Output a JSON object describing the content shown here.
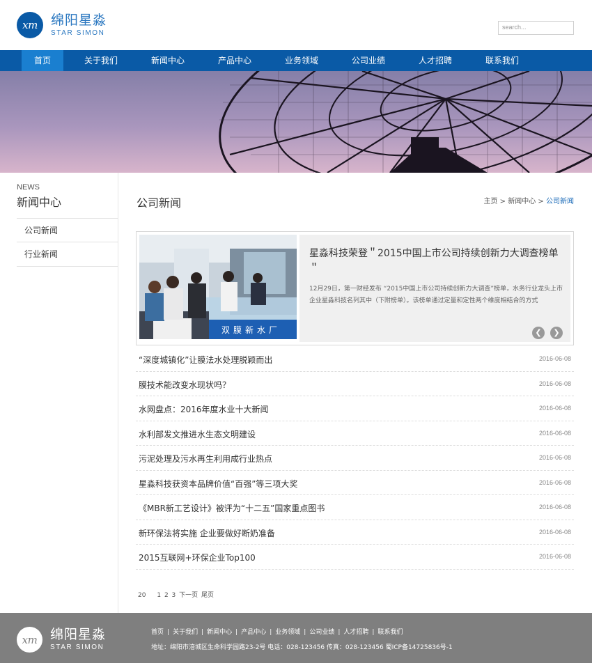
{
  "header": {
    "logo_mark": "xm",
    "logo_cn": "绵阳星淼",
    "logo_en": "STAR SIMON",
    "search_placeholder": "search..."
  },
  "nav": {
    "items": [
      "首页",
      "关于我们",
      "新闻中心",
      "产品中心",
      "业务领域",
      "公司业绩",
      "人才招聘",
      "联系我们"
    ],
    "active_index": 0
  },
  "sidebar": {
    "title_en": "NEWS",
    "title": "新闻中心",
    "items": [
      "公司新闻",
      "行业新闻"
    ]
  },
  "main": {
    "title": "公司新闻",
    "breadcrumb": [
      "主页",
      "新闻中心",
      "公司新闻"
    ],
    "breadcrumb_sep": ">",
    "featured": {
      "title": "星淼科技荣登＂2015中国上市公司持续创新力大调查榜单＂",
      "desc": "12月29日，第一财经发布 “2015中国上市公司持续创新力大调查”榜单，水务行业龙头上市企业星淼科技名列其中（下附榜单）。该榜单通过定量和定性两个维度相结合的方式",
      "image_sign": "双膜新水厂",
      "prev_icon": "chevron-left-icon",
      "next_icon": "chevron-right-icon"
    },
    "news": [
      {
        "title": "“深度城镇化”让膜法水处理脱颖而出",
        "date": "2016-06-08"
      },
      {
        "title": "膜技术能改变水现状吗？",
        "date": "2016-06-08"
      },
      {
        "title": "水网盘点：2016年度水业十大新闻",
        "date": "2016-06-08"
      },
      {
        "title": "水利部发文推进水生态文明建设",
        "date": "2016-06-08"
      },
      {
        "title": "污泥处理及污水再生利用成行业热点",
        "date": "2016-06-08"
      },
      {
        "title": "星淼科技获资本品牌价值“百强”等三项大奖",
        "date": "2016-06-08"
      },
      {
        "title": "《MBR新工艺设计》被评为“十二五”国家重点图书",
        "date": "2016-06-08"
      },
      {
        "title": "新环保法将实施 企业要做好断奶准备",
        "date": "2016-06-08"
      },
      {
        "title": "2015互联网+环保企业Top100",
        "date": "2016-06-08"
      }
    ],
    "pager": {
      "total": "20",
      "pages": [
        "1",
        "2",
        "3"
      ],
      "next": "下一页",
      "last": "尾页"
    }
  },
  "footer": {
    "logo_mark": "xm",
    "logo_cn": "绵阳星淼",
    "logo_en": "STAR SIMON",
    "links": [
      "首页",
      "关于我们",
      "新闻中心",
      "产品中心",
      "业务领域",
      "公司业绩",
      "人才招聘",
      "联系我们"
    ],
    "link_sep": "|",
    "address": "地址：绵阳市涪城区生命科学园路23-2号   电话：028-123456   传真：028-123456   蜀ICP备14725836号-1"
  },
  "colors": {
    "brand_blue": "#0a5aa6",
    "nav_active": "#1a7fd0",
    "footer_gray": "#7f7f7f",
    "link_blue": "#1a6ab8"
  }
}
